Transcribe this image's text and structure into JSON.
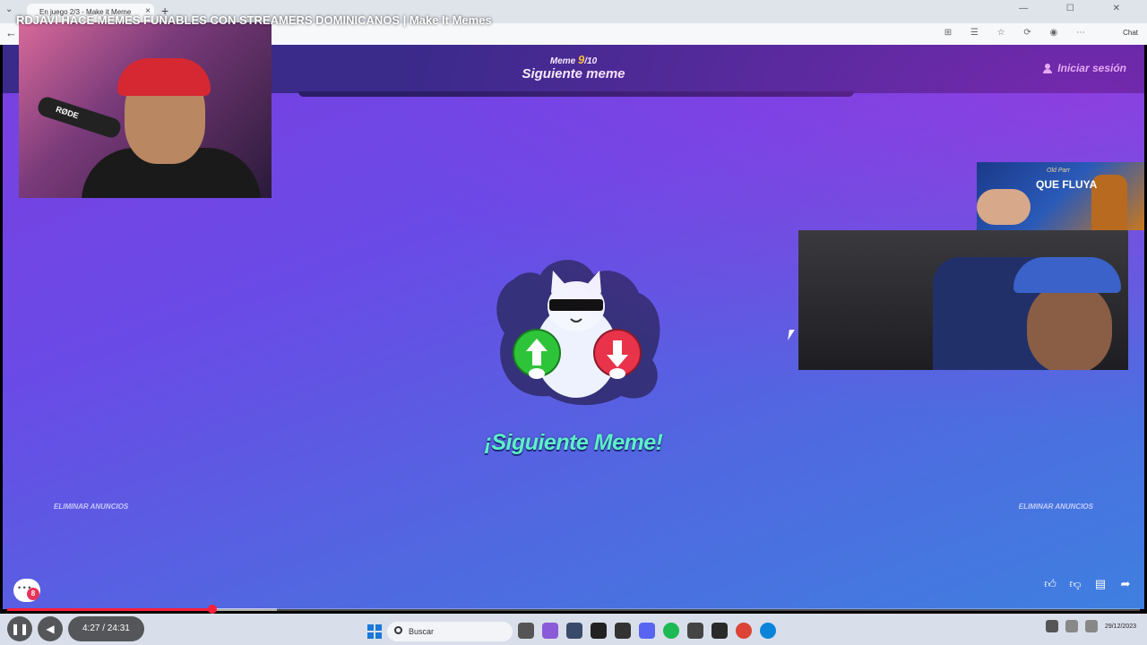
{
  "browser": {
    "tab_title": "En juego 2/3 - Make it Meme",
    "tab_close": "×",
    "new_tab": "+",
    "back": "←",
    "chat_label": "Chat",
    "window_controls": "— ☐ ✕"
  },
  "video": {
    "title": "RDJAVI HACE MEMES FUNABLES CON STREAMERS DOMINICANOS | Make It Memes",
    "current_time": "4:27",
    "duration": "24:31",
    "time_display": "4:27 / 24:31",
    "progress_fraction": 0.1815,
    "buffer_fraction": 0.238
  },
  "game": {
    "meme_label": "Meme",
    "meme_current": "9",
    "meme_total": "/10",
    "header_title": "Siguiente meme",
    "login_label": "Iniciar sesión",
    "next_meme_text": "¡Siguiente Meme!",
    "remove_ads_left": "ELIMINAR ANUNCIOS",
    "remove_ads_right": "ELIMINAR ANUNCIOS",
    "chat_badge": "8"
  },
  "ad": {
    "brand": "Old Parr",
    "tagline": "QUE FLUYA"
  },
  "webcam_left": {
    "mic_brand": "RØDE"
  },
  "taskbar": {
    "search_placeholder": "Buscar",
    "date": "29/12/2023"
  },
  "colors": {
    "header_bg": "#3a2a8a",
    "next_meme_text": "#5ef0c8",
    "upvote": "#2ec43a",
    "downvote": "#e8334a",
    "progress": "#ff1f3a"
  },
  "icons": [
    "thumbs-up-icon",
    "thumbs-down-icon",
    "comment-icon",
    "share-icon",
    "pause-icon",
    "volume-icon",
    "windows-icon",
    "search-icon",
    "user-icon"
  ]
}
